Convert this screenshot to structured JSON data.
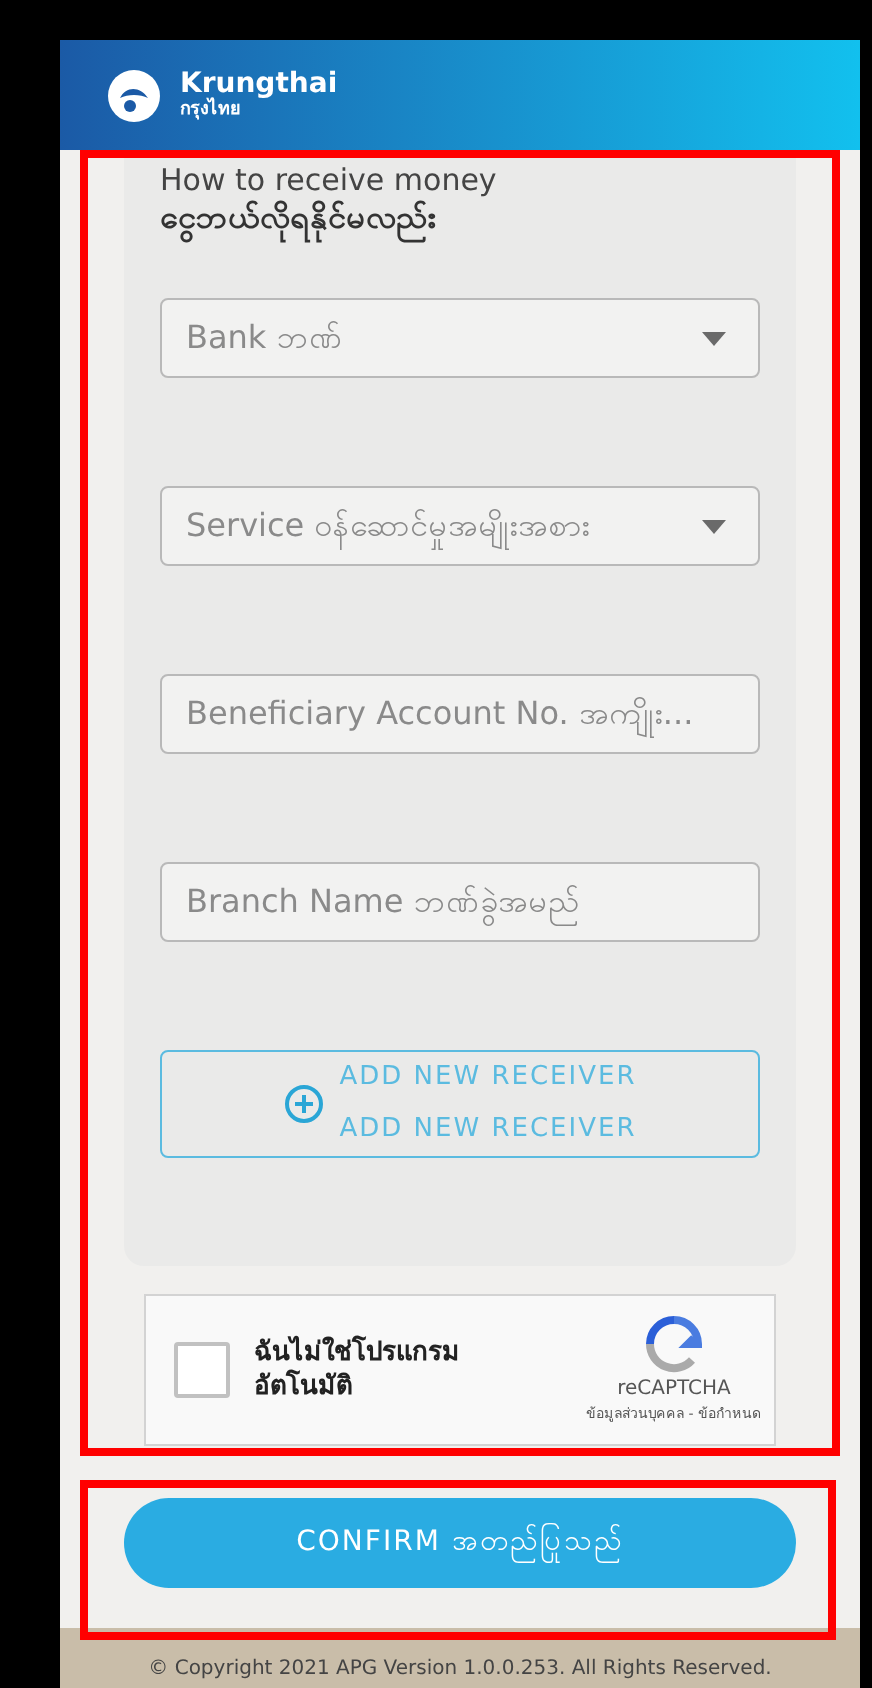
{
  "header": {
    "brand": "Krungthai",
    "brand_sub": "กรุงไทย"
  },
  "section": {
    "title": "How to receive money",
    "subtitle": "ငွေဘယ်လိုရနိုင်မလည်း"
  },
  "fields": [
    {
      "kind": "dropdown",
      "placeholder": "Bank ဘဏ်"
    },
    {
      "kind": "dropdown",
      "placeholder": "Service ဝန်ဆောင်မှုအမျိုးအစား"
    },
    {
      "kind": "text",
      "placeholder": "Beneficiary Account No. အကျိုး..."
    },
    {
      "kind": "text",
      "placeholder": "Branch Name ဘဏ်ခွဲအမည်"
    }
  ],
  "add_button": {
    "line_1": "ADD NEW RECEIVER",
    "line_2": "ADD NEW RECEIVER"
  },
  "captcha": {
    "checked": false,
    "label": "ฉันไม่ใช่โปรแกรมอัตโนมัติ",
    "brand": "reCAPTCHA",
    "links": "ข้อมูลส่วนบุคคล - ข้อกำหนด"
  },
  "confirm_button": "CONFIRM အတည်ပြုသည်",
  "footer": "© Copyright 2021 APG Version 1.0.0.253. All Rights Reserved."
}
